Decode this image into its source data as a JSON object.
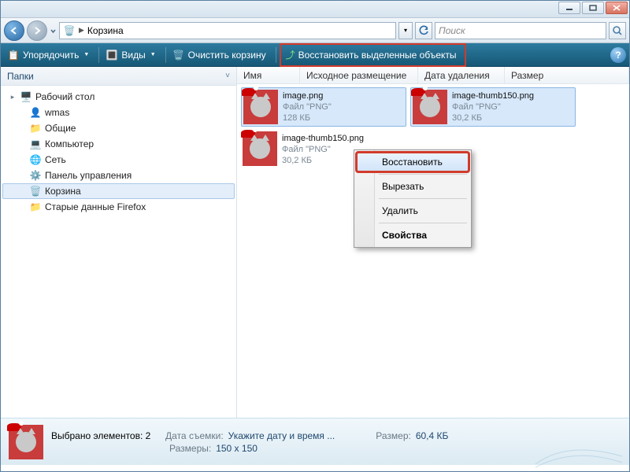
{
  "window": {
    "breadcrumb_prefix": "▶",
    "location": "Корзина",
    "search_placeholder": "Поиск"
  },
  "toolbar": {
    "organize": "Упорядочить",
    "views": "Виды",
    "empty": "Очистить корзину",
    "restore_selected": "Восстановить выделенные объекты"
  },
  "sidebar": {
    "header": "Папки",
    "items": [
      {
        "label": "Рабочий стол",
        "icon": "desktop",
        "expander": "▸"
      },
      {
        "label": "wmas",
        "icon": "user"
      },
      {
        "label": "Общие",
        "icon": "folder"
      },
      {
        "label": "Компьютер",
        "icon": "computer"
      },
      {
        "label": "Сеть",
        "icon": "network"
      },
      {
        "label": "Панель управления",
        "icon": "control"
      },
      {
        "label": "Корзина",
        "icon": "bin",
        "selected": true
      },
      {
        "label": "Старые данные Firefox",
        "icon": "folder"
      }
    ]
  },
  "columns": {
    "name": "Имя",
    "orig": "Исходное размещение",
    "deleted": "Дата удаления",
    "size": "Размер"
  },
  "files": [
    {
      "name": "image.png",
      "type": "Файл \"PNG\"",
      "size": "128 КБ",
      "selected": true
    },
    {
      "name": "image-thumb150.png",
      "type": "Файл \"PNG\"",
      "size": "30,2 КБ",
      "selected": true
    },
    {
      "name": "image-thumb150.png",
      "type": "Файл \"PNG\"",
      "size": "30,2 КБ",
      "selected": false
    }
  ],
  "context_menu": {
    "restore": "Восстановить",
    "cut": "Вырезать",
    "delete": "Удалить",
    "properties": "Свойства"
  },
  "status": {
    "selected_label": "Выбрано элементов:",
    "selected_count": "2",
    "date_label": "Дата съемки:",
    "date_value": "Укажите дату и время ...",
    "dims_label": "Размеры:",
    "dims_value": "150 x 150",
    "size_label": "Размер:",
    "size_value": "60,4 КБ"
  }
}
